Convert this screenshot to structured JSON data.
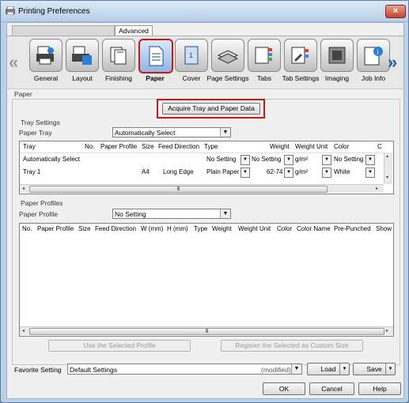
{
  "window": {
    "title": "Printing Preferences",
    "close_glyph": "×"
  },
  "tabs": {
    "advanced": "Advanced"
  },
  "toolbar": {
    "prev_glyph": "«",
    "next_glyph": "»",
    "items": [
      {
        "label": "General",
        "icon": "general-icon"
      },
      {
        "label": "Layout",
        "icon": "layout-icon"
      },
      {
        "label": "Finishing",
        "icon": "finishing-icon"
      },
      {
        "label": "Paper",
        "icon": "paper-icon",
        "active": true
      },
      {
        "label": "Cover",
        "icon": "cover-icon"
      },
      {
        "label": "Page Settings",
        "icon": "page-settings-icon"
      },
      {
        "label": "Tabs",
        "icon": "tabs-icon"
      },
      {
        "label": "Tab Settings",
        "icon": "tab-settings-icon"
      },
      {
        "label": "Imaging",
        "icon": "imaging-icon"
      },
      {
        "label": "Job Info",
        "icon": "job-info-icon"
      }
    ]
  },
  "paper": {
    "section_label": "Paper",
    "acquire_button": "Acquire Tray and Paper Data",
    "tray_settings_label": "Tray Settings",
    "paper_tray_label": "Paper Tray",
    "paper_tray_value": "Automatically Select",
    "tray_table": {
      "headers": [
        "Tray",
        "No.",
        "Paper Profile",
        "Size",
        "Feed Direction",
        "Type",
        "Weight",
        "Weight Unit",
        "Color",
        "C"
      ],
      "rows": [
        {
          "tray": "Automatically Select",
          "no": "",
          "profile": "",
          "size": "",
          "feed": "",
          "type": "No Setting",
          "weight": "No Setting",
          "unit": "g/m²",
          "color": "No Setting"
        },
        {
          "tray": "Tray 1",
          "no": "",
          "profile": "",
          "size": "A4",
          "feed": "Long Edge",
          "type": "Plain Paper",
          "weight": "62-74",
          "unit": "g/m²",
          "color": "White"
        }
      ]
    },
    "profiles_label": "Paper Profiles",
    "paper_profile_label": "Paper Profile",
    "paper_profile_value": "No Setting",
    "profile_table": {
      "headers": [
        "No.",
        "Paper Profile",
        "Size",
        "Feed Direction",
        "W (mm)",
        "H (mm)",
        "Type",
        "Weight",
        "Weight Unit",
        "Color",
        "Color Name",
        "Pre-Punched",
        "Show"
      ]
    },
    "use_selected_button": "Use the Selected Profile",
    "register_button": "Register the Selected as Custom Size"
  },
  "favorite": {
    "label": "Favorite Setting",
    "value": "Default Settings",
    "modified": "(modified)",
    "load_button": "Load",
    "save_button": "Save"
  },
  "footer": {
    "ok": "OK",
    "cancel": "Cancel",
    "help": "Help"
  },
  "scroll_glyphs": {
    "left": "◂",
    "right": "▸",
    "up": "▴",
    "down": "▾",
    "grip": "|||",
    "dropdown": "▼"
  },
  "colors": {
    "active_outline": "#d01515",
    "arrow_next": "#2a5fa8",
    "title_bar": "#b9cfe8"
  }
}
